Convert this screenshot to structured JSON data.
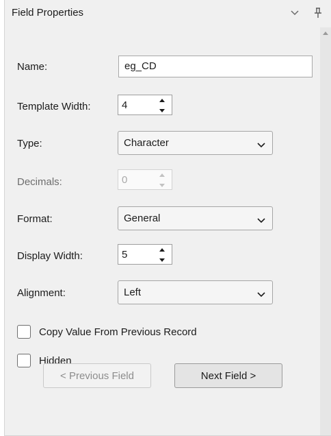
{
  "panel": {
    "title": "Field Properties",
    "title_icons": [
      "chevron-down-icon",
      "pin-icon"
    ]
  },
  "fields": {
    "name": {
      "label": "Name:",
      "value": "eg_CD"
    },
    "template_width": {
      "label": "Template Width:",
      "value": "4"
    },
    "type": {
      "label": "Type:",
      "selected": "Character"
    },
    "decimals": {
      "label": "Decimals:",
      "value": "0",
      "disabled": true
    },
    "format": {
      "label": "Format:",
      "selected": "General"
    },
    "display_width": {
      "label": "Display Width:",
      "value": "5"
    },
    "alignment": {
      "label": "Alignment:",
      "selected": "Left"
    }
  },
  "checkboxes": {
    "copy_value": {
      "label": "Copy Value From Previous Record",
      "checked": false
    },
    "hidden": {
      "label": "Hidden",
      "checked": false
    }
  },
  "buttons": {
    "previous": "< Previous Field",
    "next": "Next Field >"
  },
  "colors": {
    "panel_bg": "#f0f0f0",
    "disabled_text": "#8c8c8c"
  }
}
